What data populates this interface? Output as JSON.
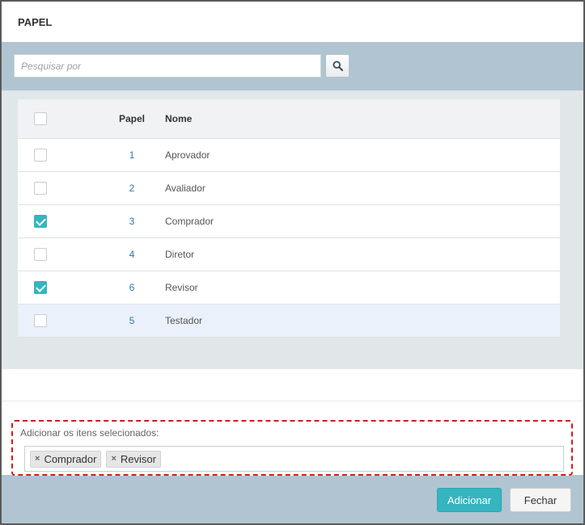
{
  "dialog": {
    "title": "PAPEL"
  },
  "search": {
    "placeholder": "Pesquisar por",
    "value": "",
    "icon": "search-icon"
  },
  "table": {
    "headers": {
      "papel": "Papel",
      "nome": "Nome"
    },
    "rows": [
      {
        "papel": "1",
        "nome": "Aprovador",
        "checked": false,
        "highlighted": false
      },
      {
        "papel": "2",
        "nome": "Avaliador",
        "checked": false,
        "highlighted": false
      },
      {
        "papel": "3",
        "nome": "Comprador",
        "checked": true,
        "highlighted": false
      },
      {
        "papel": "4",
        "nome": "Diretor",
        "checked": false,
        "highlighted": false
      },
      {
        "papel": "6",
        "nome": "Revisor",
        "checked": true,
        "highlighted": false
      },
      {
        "papel": "5",
        "nome": "Testador",
        "checked": false,
        "highlighted": true
      }
    ]
  },
  "selected": {
    "label": "Adicionar os itens selecionados:",
    "tags": [
      {
        "label": "Comprador",
        "remove": "×"
      },
      {
        "label": "Revisor",
        "remove": "×"
      }
    ]
  },
  "footer": {
    "add_label": "Adicionar",
    "close_label": "Fechar"
  },
  "colors": {
    "accent": "#35b5bf",
    "band": "#b0c5d1",
    "link": "#2f77a8",
    "highlight_row": "#eaf1fa",
    "dashed_border": "#cc1f1f"
  }
}
